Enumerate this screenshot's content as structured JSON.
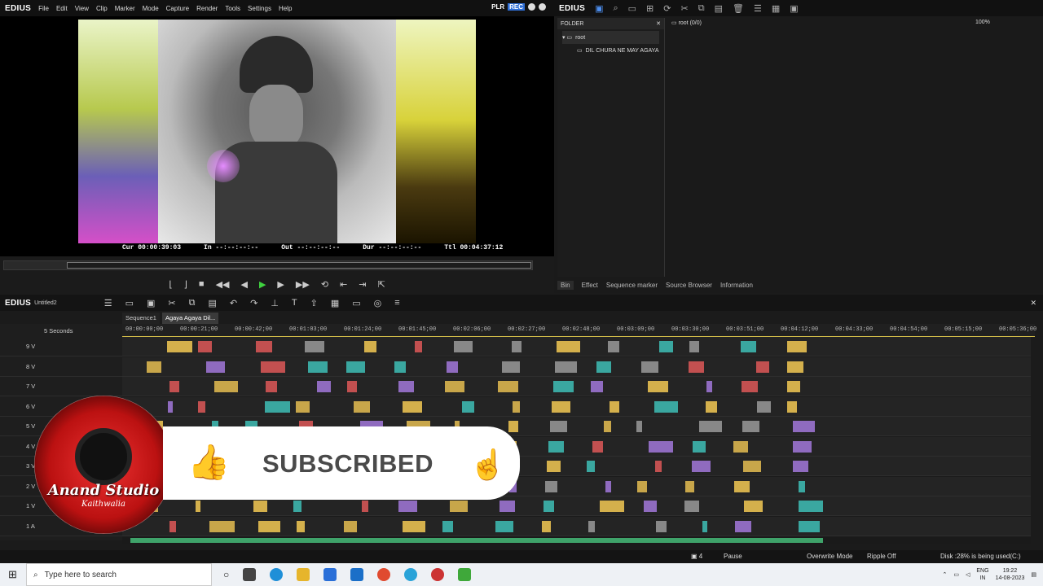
{
  "app": {
    "name": "EDIUS",
    "untitled": "Untitled2",
    "plr": "PLR",
    "rec": "REC"
  },
  "menu": [
    "File",
    "Edit",
    "View",
    "Clip",
    "Marker",
    "Mode",
    "Capture",
    "Render",
    "Tools",
    "Settings",
    "Help"
  ],
  "player": {
    "cur": "Cur 00:00:39:03",
    "in": "In --:--:--:--",
    "out": "Out --:--:--:--",
    "dur": "Dur --:--:--:--",
    "ttl": "Ttl 00:04:37:12"
  },
  "bin": {
    "folder_label": "FOLDER",
    "root": "root",
    "root_count": "root (0/0)",
    "subfolder": "DIL CHURA NE MAY AGAYA",
    "zoom": "100%",
    "tabs": [
      "Bin",
      "Effect",
      "Sequence marker",
      "Source Browser",
      "Information"
    ]
  },
  "timeline": {
    "tabs": [
      "Sequence1",
      "Agaya Agaya Dil..."
    ],
    "scale": "5 Seconds",
    "ruler": [
      "00:00:00;00",
      "00:00:21;00",
      "00:00:42;00",
      "00:01:03;00",
      "00:01:24;00",
      "00:01:45;00",
      "00:02:06;00",
      "00:02:27;00",
      "00:02:48;00",
      "00:03:09;00",
      "00:03:30;00",
      "00:03:51;00",
      "00:04:12;00",
      "00:04:33;00",
      "00:04:54;00",
      "00:05:15;00",
      "00:05:36;00"
    ],
    "tracks": [
      "9 V",
      "8 V",
      "7 V",
      "6 V",
      "5 V",
      "4 V",
      "3 V",
      "2 V",
      "1 V",
      "1 A"
    ]
  },
  "status": {
    "marker": "4",
    "state": "Pause",
    "mode": "Overwrite Mode",
    "ripple": "Ripple Off",
    "disk": "Disk :28% is being used(C:)"
  },
  "overlay": {
    "studio": "Anand Studio",
    "sub": "Kaithwalia",
    "subscribed": "SUBSCRIBED"
  },
  "taskbar": {
    "search": "Type here to search",
    "lang": "ENG",
    "region": "IN",
    "time": "19:22",
    "date": "14-08-2023"
  }
}
